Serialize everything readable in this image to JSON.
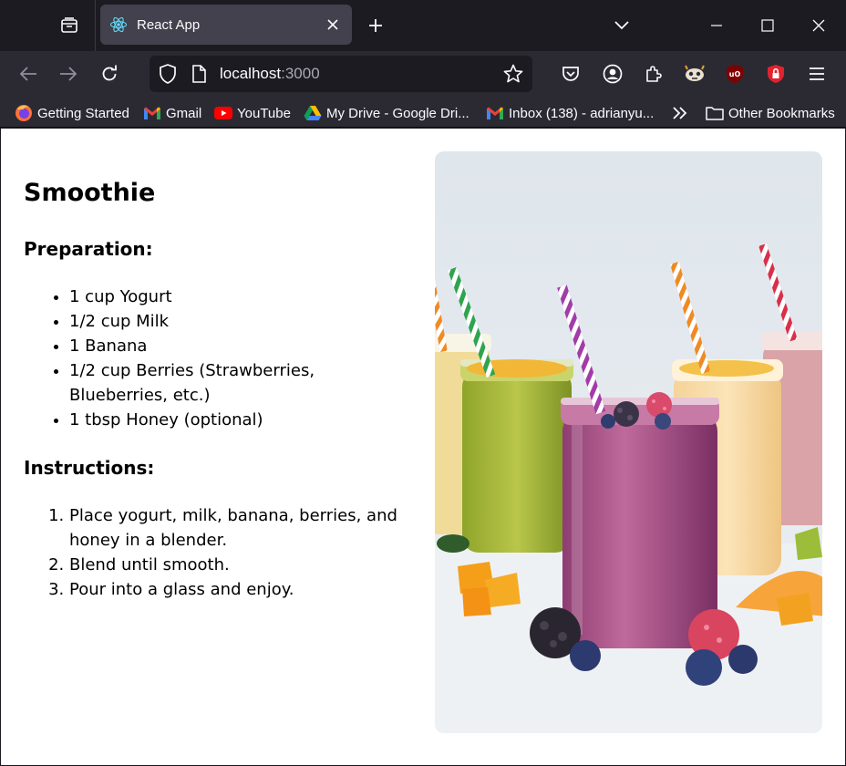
{
  "browser": {
    "tab": {
      "title": "React App"
    },
    "url": {
      "host": "localhost",
      "port": ":3000"
    },
    "bookmarks": [
      {
        "label": "Getting Started",
        "icon": "firefox-icon"
      },
      {
        "label": "Gmail",
        "icon": "gmail-icon"
      },
      {
        "label": "YouTube",
        "icon": "youtube-icon"
      },
      {
        "label": "My Drive - Google Dri...",
        "icon": "google-drive-icon"
      },
      {
        "label": "Inbox (138) - adrianyu...",
        "icon": "gmail-icon"
      }
    ],
    "other_bookmarks": "Other Bookmarks"
  },
  "recipe": {
    "title": "Smoothie",
    "preparation_heading": "Preparation:",
    "ingredients": [
      "1 cup Yogurt",
      "1/2 cup Milk",
      "1 Banana",
      "1/2 cup Berries (Strawberries, Blueberries, etc.)",
      "1 tbsp Honey (optional)"
    ],
    "instructions_heading": "Instructions:",
    "steps": [
      "Place yogurt, milk, banana, berries, and honey in a blender.",
      "Blend until smooth.",
      "Pour into a glass and enjoy."
    ]
  },
  "colors": {
    "chrome_dark": "#1c1b22",
    "toolbar": "#2b2a33",
    "tab_active": "#42414d",
    "ublock_red": "#800000",
    "smoothie_purple": "#b05a8e",
    "smoothie_green": "#a6b83a",
    "smoothie_orange": "#f2c98a"
  }
}
